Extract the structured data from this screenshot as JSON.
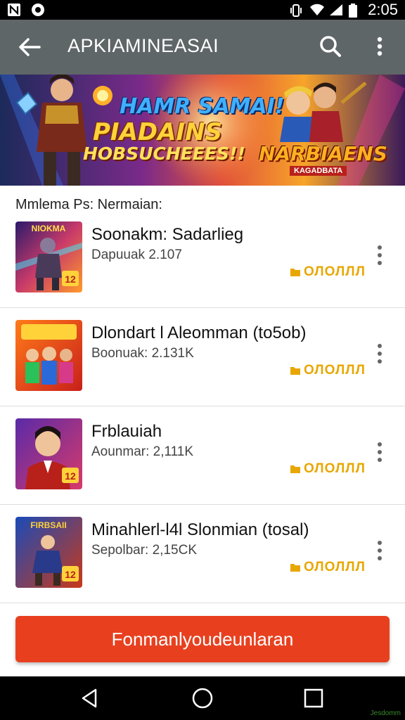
{
  "status_bar": {
    "time": "2:05",
    "icons": [
      "n-notification-icon",
      "circle-notification-icon",
      "vibrate-icon",
      "wifi-icon",
      "signal-icon",
      "battery-icon"
    ]
  },
  "app_bar": {
    "title": "APKIAMINEASAI",
    "icons": [
      "back-arrow-icon",
      "search-icon",
      "more-vert-icon"
    ]
  },
  "banner": {
    "line1": "HAMR SAMAI!",
    "line2": "PIADAINS",
    "line3": "HOBSUCHEEES!!",
    "logo": "NARBIAENS",
    "logo_sub": "KAGADBATA"
  },
  "section": {
    "title": "Mmlema Ps: Nermaian:"
  },
  "apps": [
    {
      "name": "Soonakm: Sadarlieg",
      "meta": "Dapuuak 2.107",
      "install_label": "ОЛОЛЛЛ",
      "badge": "12"
    },
    {
      "name": "Dlondart l Aleomman (to5ob)",
      "meta": "Boonuak: 2.131K",
      "install_label": "ОЛОЛЛЛ",
      "badge": ""
    },
    {
      "name": "Frblauiah",
      "meta": "Aounmar: 2,111K",
      "install_label": "ОЛОЛЛЛ",
      "badge": "12"
    },
    {
      "name": "Minahlerl-l4l Slonmian (tosal)",
      "meta": "Sepolbar: 2,15CK",
      "install_label": "ОЛОЛЛЛ",
      "badge": "12"
    }
  ],
  "thumb_titles": [
    "NIOKMA",
    "",
    "",
    "FIRBSAII"
  ],
  "cta": {
    "label": "Fonmanlyoudeunlaran"
  },
  "nav_bar": {
    "icons": [
      "back-triangle-icon",
      "home-circle-icon",
      "recents-square-icon"
    ],
    "watermark": "Jesdomm"
  },
  "colors": {
    "status_bar": "#000000",
    "app_bar": "#5f6668",
    "accent_install": "#e8a700",
    "cta": "#e8401f",
    "divider": "#dedede"
  }
}
